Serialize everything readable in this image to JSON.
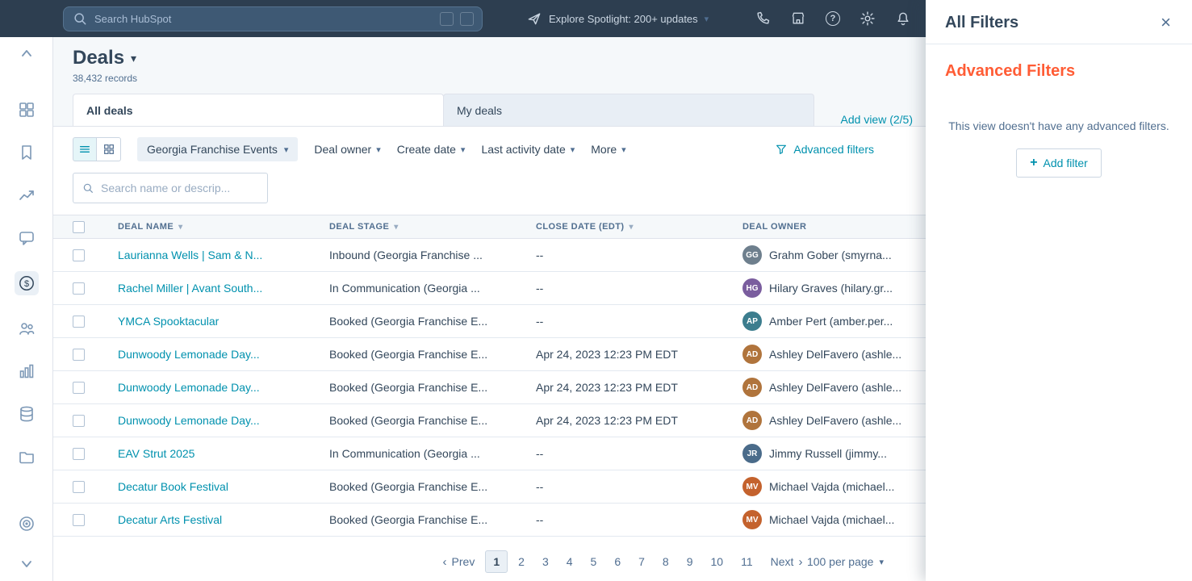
{
  "glyphs": {
    "caret_down": "▾",
    "chevron_left": "‹",
    "chevron_right": "›",
    "plus": "+",
    "close": "×",
    "sort": "▾",
    "dollar": "$",
    "question": "?"
  },
  "colors": {
    "nav_bg": "#2d3e50",
    "accent_orange": "#ff5c35",
    "link_blue": "#0091ae"
  },
  "topnav": {
    "search_placeholder": "Search HubSpot",
    "explore_label": "Explore Spotlight: 200+ updates",
    "icons": [
      "search-icon",
      "keyboard-shortcut-icon",
      "rocket-icon",
      "caret-down-icon",
      "calls-icon",
      "marketplace-icon",
      "help-icon",
      "settings-icon",
      "notifications-icon"
    ]
  },
  "sidebar": {
    "icons": [
      "collapse-icon",
      "apps-grid-icon",
      "bookmark-icon",
      "trend-icon",
      "chat-icon",
      "sales-dollar-icon",
      "contacts-icon",
      "bar-chart-icon",
      "database-icon",
      "folder-icon",
      "target-icon",
      "chevron-down-icon"
    ]
  },
  "page": {
    "title": "Deals",
    "records_count": "38,432 records",
    "tabs": [
      {
        "label": "All deals"
      },
      {
        "label": "My deals"
      }
    ],
    "add_view_label": "Add view (2/5)"
  },
  "filters": {
    "view_selector": "Georgia Franchise Events",
    "dropdowns": [
      "Deal owner",
      "Create date",
      "Last activity date",
      "More"
    ],
    "advanced_label": "Advanced filters"
  },
  "search": {
    "placeholder": "Search name or descrip..."
  },
  "table": {
    "columns": [
      "Deal name",
      "Deal Stage",
      "Close date (EDT)",
      "Deal owner"
    ],
    "rows": [
      {
        "name": "Laurianna Wells | Sam & N...",
        "stage": "Inbound (Georgia Franchise ...",
        "close_date": "--",
        "owner": "Grahm Gober (smyrna...",
        "initials": "GG",
        "avatar_color": "#6e7f8d"
      },
      {
        "name": "Rachel Miller | Avant South...",
        "stage": "In Communication (Georgia ...",
        "close_date": "--",
        "owner": "Hilary Graves (hilary.gr...",
        "initials": "HG",
        "avatar_color": "#7a5d9e"
      },
      {
        "name": "YMCA Spooktacular",
        "stage": "Booked (Georgia Franchise E...",
        "close_date": "--",
        "owner": "Amber Pert (amber.per...",
        "initials": "AP",
        "avatar_color": "#3c7d8e"
      },
      {
        "name": "Dunwoody Lemonade Day...",
        "stage": "Booked (Georgia Franchise E...",
        "close_date": "Apr 24, 2023 12:23 PM EDT",
        "owner": "Ashley DelFavero (ashle...",
        "initials": "AD",
        "avatar_color": "#b0743c"
      },
      {
        "name": "Dunwoody Lemonade Day...",
        "stage": "Booked (Georgia Franchise E...",
        "close_date": "Apr 24, 2023 12:23 PM EDT",
        "owner": "Ashley DelFavero (ashle...",
        "initials": "AD",
        "avatar_color": "#b0743c"
      },
      {
        "name": "Dunwoody Lemonade Day...",
        "stage": "Booked (Georgia Franchise E...",
        "close_date": "Apr 24, 2023 12:23 PM EDT",
        "owner": "Ashley DelFavero (ashle...",
        "initials": "AD",
        "avatar_color": "#b0743c"
      },
      {
        "name": "EAV Strut 2025",
        "stage": "In Communication (Georgia ...",
        "close_date": "--",
        "owner": "Jimmy Russell (jimmy...",
        "initials": "JR",
        "avatar_color": "#4a6b8a"
      },
      {
        "name": "Decatur Book Festival",
        "stage": "Booked (Georgia Franchise E...",
        "close_date": "--",
        "owner": "Michael Vajda (michael...",
        "initials": "MV",
        "avatar_color": "#c4622d"
      },
      {
        "name": "Decatur Arts Festival",
        "stage": "Booked (Georgia Franchise E...",
        "close_date": "--",
        "owner": "Michael Vajda (michael...",
        "initials": "MV",
        "avatar_color": "#c4622d"
      }
    ]
  },
  "pagination": {
    "prev": "Prev",
    "next": "Next",
    "pages": [
      "1",
      "2",
      "3",
      "4",
      "5",
      "6",
      "7",
      "8",
      "9",
      "10",
      "11"
    ],
    "active_page": "1",
    "per_page": "100 per page"
  },
  "panel": {
    "title": "All Filters",
    "heading": "Advanced Filters",
    "empty_text": "This view doesn't have any advanced filters.",
    "add_filter_label": "Add filter"
  }
}
